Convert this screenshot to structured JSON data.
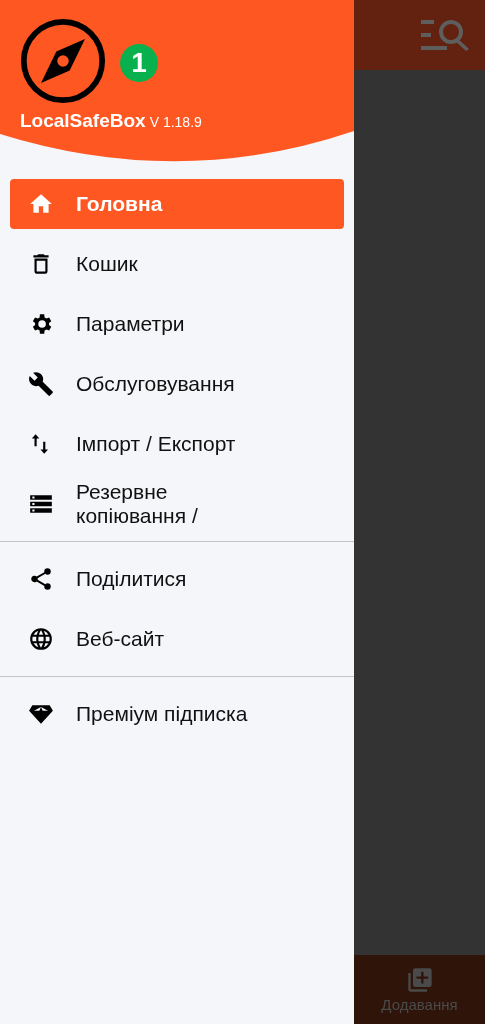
{
  "drawer": {
    "app_name": "LocalSafeBox",
    "version": "V 1.18.9",
    "badge": "1",
    "sections": [
      {
        "items": [
          {
            "label": "Головна",
            "selected": true
          },
          {
            "label": "Кошик",
            "selected": false
          },
          {
            "label": "Параметри",
            "selected": false
          },
          {
            "label": "Обслуговування",
            "selected": false
          },
          {
            "label": "Імпорт / Експорт",
            "selected": false
          },
          {
            "label": "Резервне копіювання /",
            "selected": false
          }
        ]
      },
      {
        "items": [
          {
            "label": "Поділитися",
            "selected": false
          },
          {
            "label": "Веб-сайт",
            "selected": false
          }
        ]
      },
      {
        "items": [
          {
            "label": "Преміум підписка",
            "selected": false
          }
        ]
      }
    ]
  },
  "bottom_nav": {
    "label": "Додавання"
  }
}
